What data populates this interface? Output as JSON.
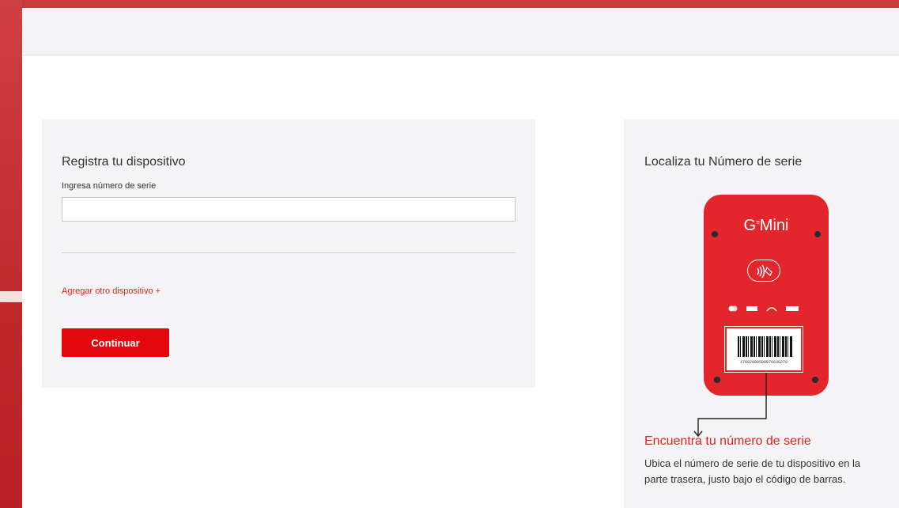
{
  "register": {
    "title": "Registra tu dispositivo",
    "serial_label": "Ingresa número de serie",
    "serial_value": "",
    "add_device_link": "Agregar otro dispositivo +",
    "continue_button": "Continuar"
  },
  "locate": {
    "title": "Localiza tu Número de serie",
    "device_brand": "G",
    "device_brand_sup": "≡",
    "device_model": "Mini",
    "barcode_number": "17682000500B7663G279",
    "find_title": "Encuentra tu número de serie",
    "find_description": "Ubica el número de serie de tu dispositivo en la parte trasera, justo bajo el código de barras."
  },
  "colors": {
    "accent_red": "#e2070e",
    "device_red": "#e3262c",
    "background_red": "#c9393d"
  }
}
